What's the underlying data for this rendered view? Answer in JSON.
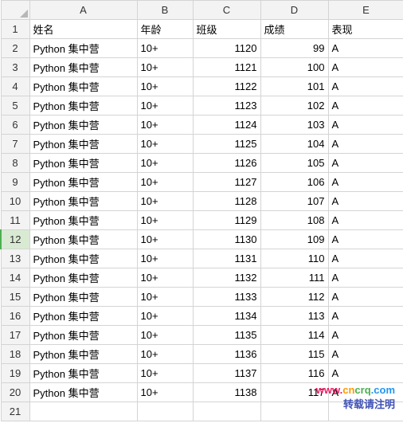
{
  "columns": [
    "A",
    "B",
    "C",
    "D",
    "E"
  ],
  "rowNumbers": [
    1,
    2,
    3,
    4,
    5,
    6,
    7,
    8,
    9,
    10,
    11,
    12,
    13,
    14,
    15,
    16,
    17,
    18,
    19,
    20,
    21
  ],
  "selectedRow": 12,
  "headers": {
    "A": "姓名",
    "B": "年龄",
    "C": "班级",
    "D": "成绩",
    "E": "表现"
  },
  "rows": [
    {
      "A": "Python 集中营",
      "B": "10+",
      "C": 1120,
      "D": 99,
      "E": "A"
    },
    {
      "A": "Python 集中营",
      "B": "10+",
      "C": 1121,
      "D": 100,
      "E": "A"
    },
    {
      "A": "Python 集中营",
      "B": "10+",
      "C": 1122,
      "D": 101,
      "E": "A"
    },
    {
      "A": "Python 集中营",
      "B": "10+",
      "C": 1123,
      "D": 102,
      "E": "A"
    },
    {
      "A": "Python 集中营",
      "B": "10+",
      "C": 1124,
      "D": 103,
      "E": "A"
    },
    {
      "A": "Python 集中营",
      "B": "10+",
      "C": 1125,
      "D": 104,
      "E": "A"
    },
    {
      "A": "Python 集中营",
      "B": "10+",
      "C": 1126,
      "D": 105,
      "E": "A"
    },
    {
      "A": "Python 集中营",
      "B": "10+",
      "C": 1127,
      "D": 106,
      "E": "A"
    },
    {
      "A": "Python 集中营",
      "B": "10+",
      "C": 1128,
      "D": 107,
      "E": "A"
    },
    {
      "A": "Python 集中营",
      "B": "10+",
      "C": 1129,
      "D": 108,
      "E": "A"
    },
    {
      "A": "Python 集中营",
      "B": "10+",
      "C": 1130,
      "D": 109,
      "E": "A"
    },
    {
      "A": "Python 集中营",
      "B": "10+",
      "C": 1131,
      "D": 110,
      "E": "A"
    },
    {
      "A": "Python 集中营",
      "B": "10+",
      "C": 1132,
      "D": 111,
      "E": "A"
    },
    {
      "A": "Python 集中营",
      "B": "10+",
      "C": 1133,
      "D": 112,
      "E": "A"
    },
    {
      "A": "Python 集中营",
      "B": "10+",
      "C": 1134,
      "D": 113,
      "E": "A"
    },
    {
      "A": "Python 集中营",
      "B": "10+",
      "C": 1135,
      "D": 114,
      "E": "A"
    },
    {
      "A": "Python 集中营",
      "B": "10+",
      "C": 1136,
      "D": 115,
      "E": "A"
    },
    {
      "A": "Python 集中营",
      "B": "10+",
      "C": 1137,
      "D": 116,
      "E": "A"
    },
    {
      "A": "Python 集中营",
      "B": "10+",
      "C": 1138,
      "D": 117,
      "E": "A"
    }
  ],
  "alignments": {
    "A": "left",
    "B": "left",
    "C": "right",
    "D": "right",
    "E": "left"
  },
  "watermark": {
    "line1": "www.cncrq.com",
    "line2": "转载请注明"
  }
}
